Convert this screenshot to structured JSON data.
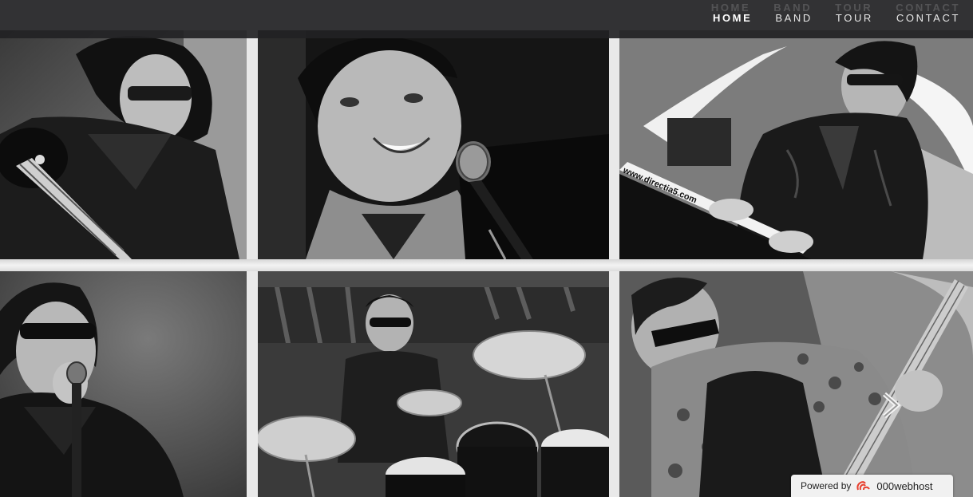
{
  "nav": {
    "items": [
      {
        "label": "HOME",
        "active": true
      },
      {
        "label": "BAND",
        "active": false
      },
      {
        "label": "TOUR",
        "active": false
      },
      {
        "label": "CONTACT",
        "active": false
      }
    ]
  },
  "gallery": {
    "photos": [
      {
        "subject": "bassist"
      },
      {
        "subject": "smiling singer at microphone"
      },
      {
        "subject": "keyboardist",
        "visible_text": "www.directia5.com"
      },
      {
        "subject": "singer with microphone"
      },
      {
        "subject": "drummer"
      },
      {
        "subject": "guitarist"
      }
    ]
  },
  "slider": {
    "next_icon": "chevron-right-icon"
  },
  "badge": {
    "powered_label": "Powered by",
    "brand": "000webhost",
    "brand_color": "#e8402f"
  },
  "colors": {
    "navbar_bg": "#222224",
    "nav_text": "#e8e8e8",
    "gutter": "#e9e9e9"
  }
}
